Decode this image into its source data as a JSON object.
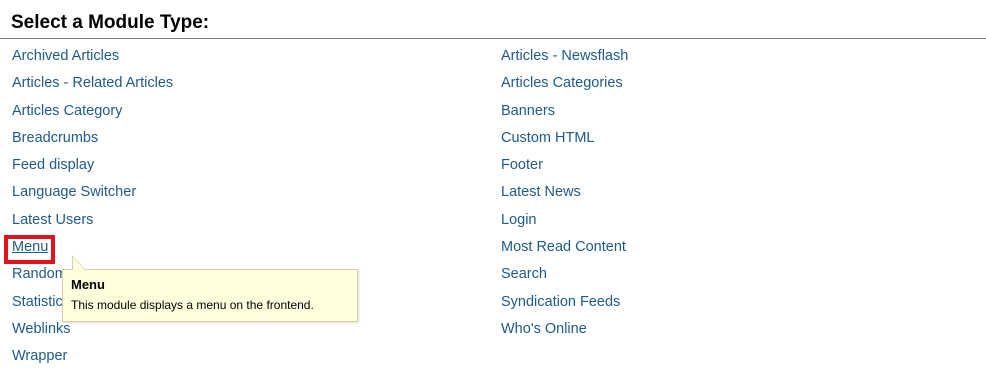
{
  "header": {
    "title": "Select a Module Type:"
  },
  "modules": {
    "left": [
      "Archived Articles",
      "Articles - Related Articles",
      "Articles Category",
      "Breadcrumbs",
      "Feed display",
      "Language Switcher",
      "Latest Users",
      "Menu",
      "Random Image",
      "Statistics",
      "Weblinks",
      "Wrapper"
    ],
    "right": [
      "Articles - Newsflash",
      "Articles Categories",
      "Banners",
      "Custom HTML",
      "Footer",
      "Latest News",
      "Login",
      "Most Read Content",
      "Search",
      "Syndication Feeds",
      "Who's Online"
    ]
  },
  "tooltip": {
    "title": "Menu",
    "description": "This module displays a menu on the frontend."
  },
  "colors": {
    "link": "#1e5a8a",
    "highlight": "#e0141e",
    "tooltip_bg": "#ffffdd"
  }
}
